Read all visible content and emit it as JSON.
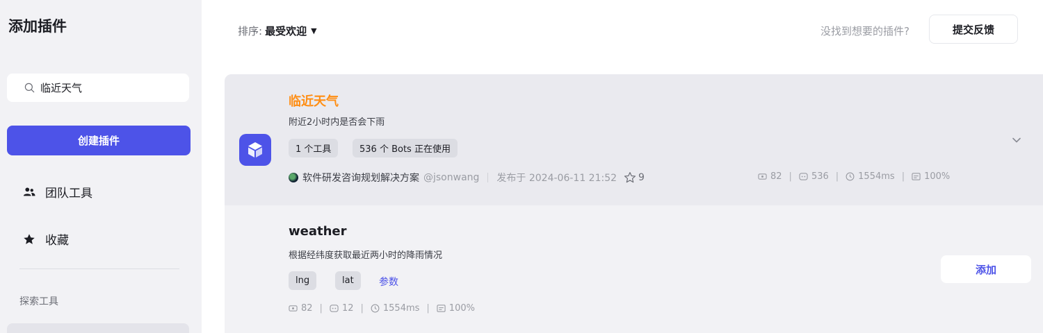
{
  "sidebar": {
    "title": "添加插件",
    "search": {
      "value": "临近天气",
      "icon": "search-icon"
    },
    "create_button": "创建插件",
    "nav": [
      {
        "label": "团队工具",
        "icon": "team-icon"
      },
      {
        "label": "收藏",
        "icon": "star-icon"
      }
    ],
    "section_label": "探索工具"
  },
  "topbar": {
    "sort_label": "排序:",
    "sort_value": "最受欢迎",
    "sort_caret": "▼",
    "hint": "没找到想要的插件?",
    "feedback_button": "提交反馈"
  },
  "plugin": {
    "name": "临近天气",
    "description": "附近2小时内是否会下雨",
    "tags": [
      "1 个工具",
      "536 个 Bots 正在使用"
    ],
    "author": "软件研发咨询规划解决方案",
    "author_handle": "@jsonwang",
    "published": "发布于 2024-06-11 21:52",
    "stars": "9",
    "stats": {
      "calls": "82",
      "bots": "536",
      "latency": "1554ms",
      "success": "100%"
    },
    "accent": "#ff8e14",
    "icon": "cube-icon"
  },
  "tool": {
    "name": "weather",
    "description": "根据经纬度获取最近两小时的降雨情况",
    "params": [
      "lng",
      "lat"
    ],
    "params_link": "参数",
    "stats": {
      "calls": "82",
      "bots": "12",
      "latency": "1554ms",
      "success": "100%"
    },
    "add_button": "添加"
  },
  "colors": {
    "primary": "#4d53e8",
    "sidebar_bg": "#f2f2f5"
  }
}
